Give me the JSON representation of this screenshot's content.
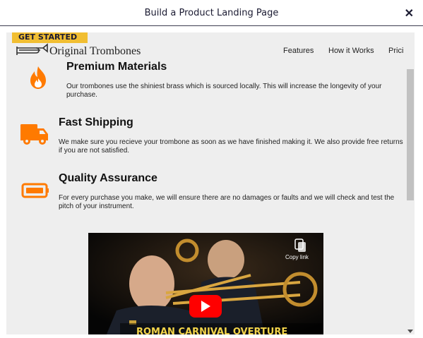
{
  "window": {
    "title": "Build a Product Landing Page",
    "close_glyph": "✕"
  },
  "header": {
    "get_started": "GET STARTED",
    "logo_text": "Original Trombones",
    "nav": [
      "Features",
      "How it Works",
      "Prici"
    ]
  },
  "features": [
    {
      "icon": "fire-icon",
      "title": "Premium Materials",
      "text": "Our trombones use the shiniest brass which is sourced locally. This will increase the longevity of your purchase."
    },
    {
      "icon": "truck-icon",
      "title": "Fast Shipping",
      "text": "We make sure you recieve your trombone as soon as we have finished making it. We also provide free returns if you are not satisfied."
    },
    {
      "icon": "battery-icon",
      "title": "Quality Assurance",
      "text": "For every purchase you make, we will ensure there are no damages or faults and we will check and test the pitch of your instrument."
    }
  ],
  "video": {
    "copy_link_label": "Copy link",
    "caption": "ROMAN CARNIVAL OVERTURE"
  },
  "colors": {
    "accent": "#f1be32",
    "icon_orange": "#ff7a00",
    "youtube_red": "#ff0000"
  }
}
